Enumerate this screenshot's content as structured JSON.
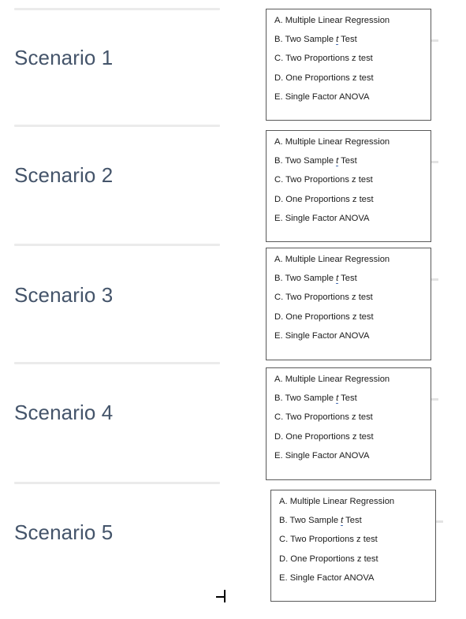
{
  "document": {
    "background_color": "#ffffff",
    "heading_color": "#44546a",
    "divider_color": "#ebebeb",
    "box_border_color": "#595959",
    "option_text_color": "#1b1b1b",
    "stat_symbol_underline_color": "#4a6fb5"
  },
  "options": {
    "a_prefix": "A. ",
    "a_text": "Multiple Linear Regression",
    "b_prefix": "B. ",
    "b_text_before": "Two Sample ",
    "b_symbol": "t",
    "b_text_after": " Test",
    "c_prefix": "C. ",
    "c_text": "Two Proportions z test",
    "d_prefix": "D. ",
    "d_text": "One Proportions z test",
    "e_prefix": "E. ",
    "e_text": "Single Factor ANOVA"
  },
  "scenarios": [
    {
      "heading": "Scenario 1"
    },
    {
      "heading": "Scenario 2"
    },
    {
      "heading": "Scenario 3"
    },
    {
      "heading": "Scenario 4"
    },
    {
      "heading": "Scenario 5"
    }
  ]
}
